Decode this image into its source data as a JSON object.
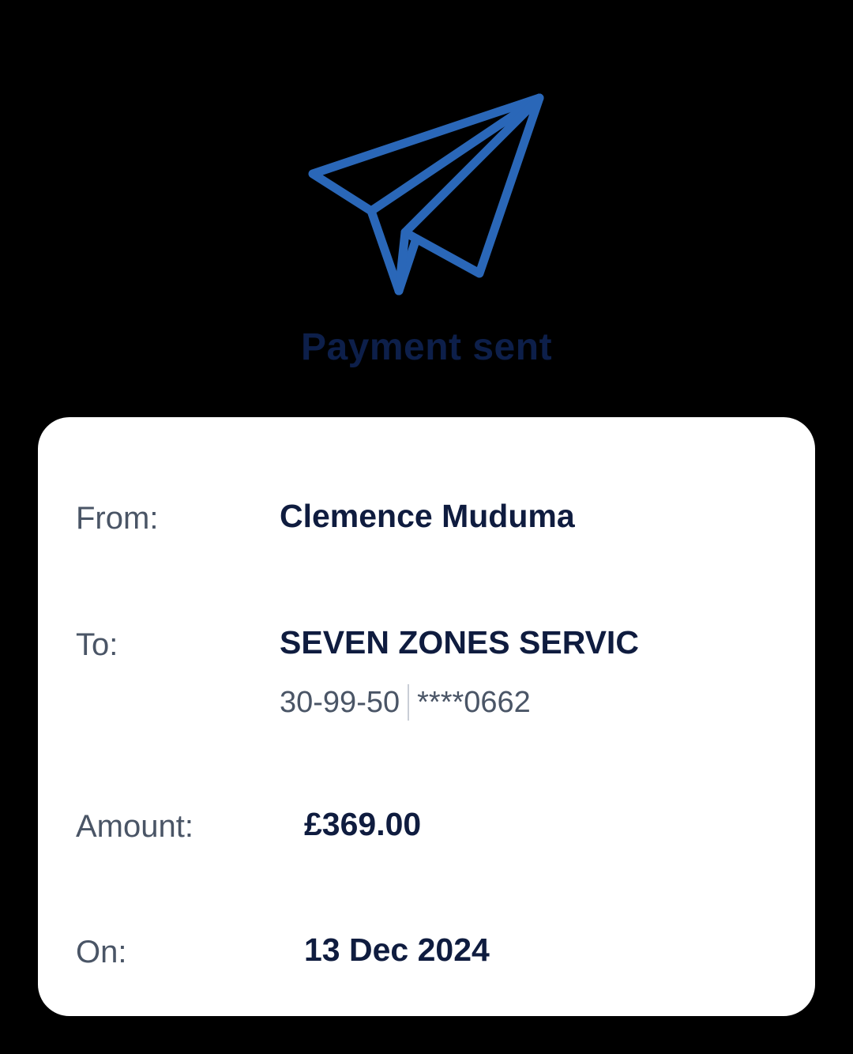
{
  "header": {
    "icon": "paper-plane-icon",
    "title": "Payment sent",
    "accent_color": "#2a67b8"
  },
  "details": {
    "from_label": "From:",
    "from_value": "Clemence Muduma",
    "to_label": "To:",
    "to_value": "SEVEN ZONES SERVIC",
    "sort_code": "30-99-50",
    "account_masked": "****0662",
    "amount_label": "Amount:",
    "amount_value": "£369.00",
    "date_label": "On:",
    "date_value": "13 Dec 2024"
  }
}
